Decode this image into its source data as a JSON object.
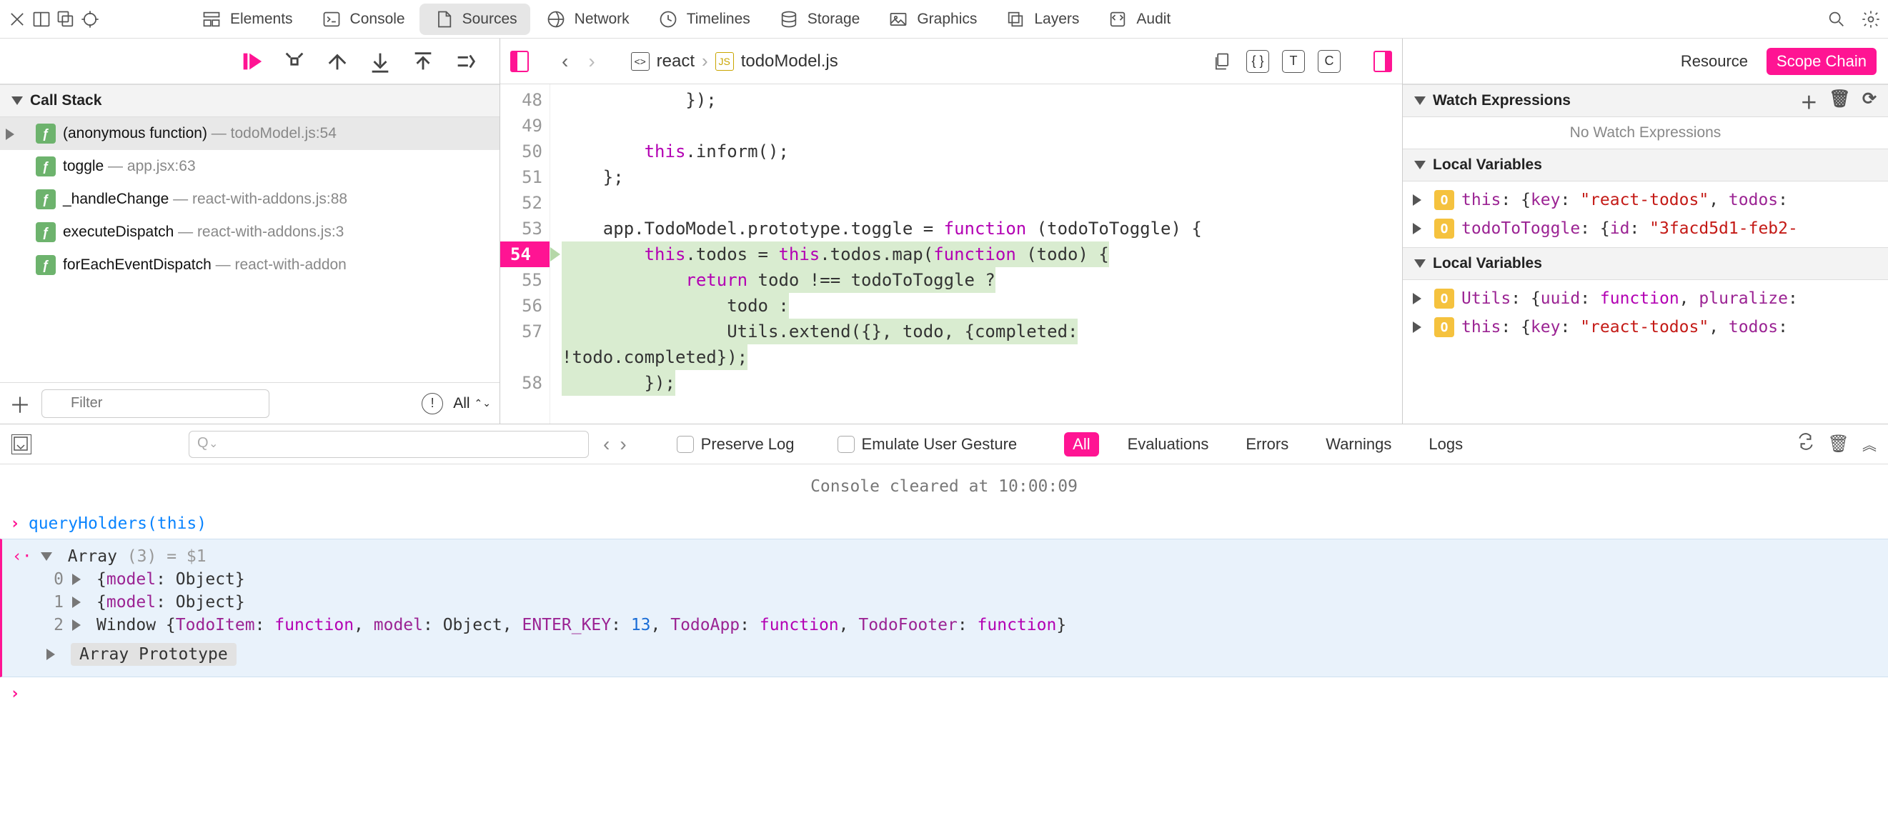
{
  "topTabs": [
    {
      "label": "Elements"
    },
    {
      "label": "Console"
    },
    {
      "label": "Sources",
      "active": true
    },
    {
      "label": "Network"
    },
    {
      "label": "Timelines"
    },
    {
      "label": "Storage"
    },
    {
      "label": "Graphics"
    },
    {
      "label": "Layers"
    },
    {
      "label": "Audit"
    }
  ],
  "callStack": {
    "title": "Call Stack",
    "frames": [
      {
        "name": "(anonymous function)",
        "loc": "todoModel.js:54",
        "active": true
      },
      {
        "name": "toggle",
        "loc": "app.jsx:63"
      },
      {
        "name": "_handleChange",
        "loc": "react-with-addons.js:88"
      },
      {
        "name": "executeDispatch",
        "loc": "react-with-addons.js:3"
      },
      {
        "name": "forEachEventDispatch",
        "loc": "react-with-addon"
      }
    ],
    "filterPlaceholder": "Filter",
    "levelLabel": "All"
  },
  "breadcrumb": {
    "root": "react",
    "file": "todoModel.js"
  },
  "source": {
    "startLine": 48,
    "breakpointLine": 54,
    "lines": [
      "            });",
      "",
      "        this.inform();",
      "    };",
      "",
      "    app.TodoModel.prototype.toggle = function (todoToToggle) {",
      "        this.todos = this.todos.map(function (todo) {",
      "            return todo !== todoToToggle ?",
      "                todo :",
      "                Utils.extend({}, todo, {completed:",
      "!todo.completed});",
      "        });"
    ],
    "lastLineNumber": 58
  },
  "rightBar": {
    "modes": [
      "Resource",
      "Scope Chain"
    ],
    "activeMode": "Scope Chain"
  },
  "watch": {
    "title": "Watch Expressions",
    "empty": "No Watch Expressions"
  },
  "scopes": [
    {
      "title": "Local Variables",
      "entries": [
        {
          "key": "this",
          "value": "{key: \"react-todos\", todos:"
        },
        {
          "key": "todoToToggle",
          "value": "{id: \"3facd5d1-feb2-"
        }
      ]
    },
    {
      "title": "Local Variables",
      "entries": [
        {
          "key": "Utils",
          "value": "{uuid: function, pluralize:"
        },
        {
          "key": "this",
          "value": "{key: \"react-todos\", todos:"
        }
      ]
    }
  ],
  "consoleToolbar": {
    "preserveLog": "Preserve Log",
    "emulateGesture": "Emulate User Gesture",
    "filters": [
      "All",
      "Evaluations",
      "Errors",
      "Warnings",
      "Logs"
    ],
    "activeFilter": "All"
  },
  "console": {
    "cleared": "Console cleared at 10:00:09",
    "input": "queryHolders(this)",
    "result": {
      "header": "Array (3) = $1",
      "items": [
        "{model: Object}",
        "{model: Object}",
        "Window {TodoItem: function, model: Object, ENTER_KEY: 13, TodoApp: function, TodoFooter: function}"
      ],
      "proto": "Array Prototype"
    }
  }
}
